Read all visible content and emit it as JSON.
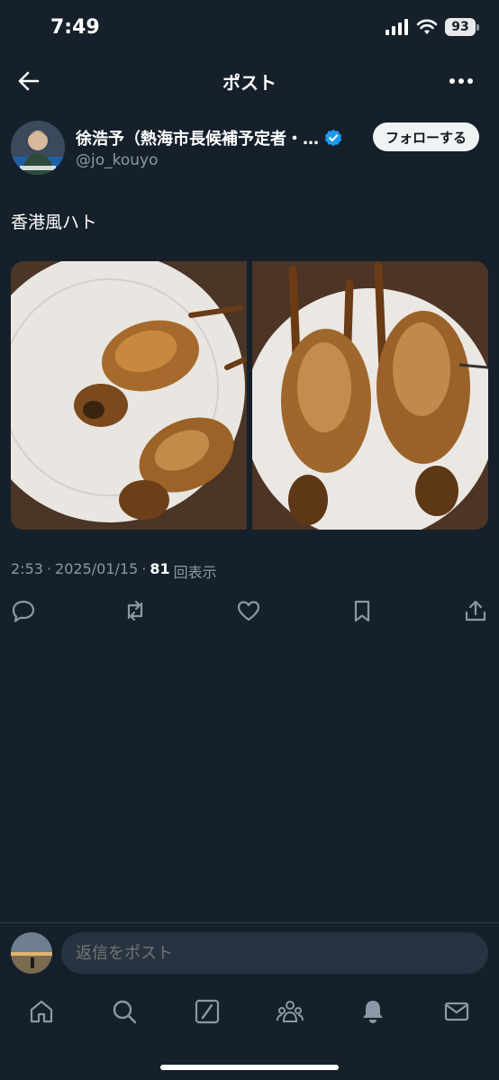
{
  "status": {
    "time": "7:49",
    "battery": "93"
  },
  "nav": {
    "title": "ポスト"
  },
  "author": {
    "display_name": "徐浩予（熱海市長候補予定者・…",
    "handle": "@jo_kouyo",
    "follow_label": "フォローする"
  },
  "tweet": {
    "text": "香港風ハト"
  },
  "meta": {
    "time": "2:53",
    "date": "2025/01/15",
    "views": "81",
    "views_label": "回表示",
    "sep": "·"
  },
  "reply": {
    "placeholder": "返信をポスト"
  },
  "colors": {
    "background": "#15202b",
    "verified": "#1d9bf0",
    "muted": "#8b98a5"
  },
  "icons": {
    "actions": [
      "reply-icon",
      "repost-icon",
      "like-icon",
      "bookmark-icon",
      "share-icon"
    ],
    "tabs": [
      "home-icon",
      "search-icon",
      "grok-icon",
      "communities-icon",
      "notifications-icon",
      "messages-icon"
    ]
  }
}
